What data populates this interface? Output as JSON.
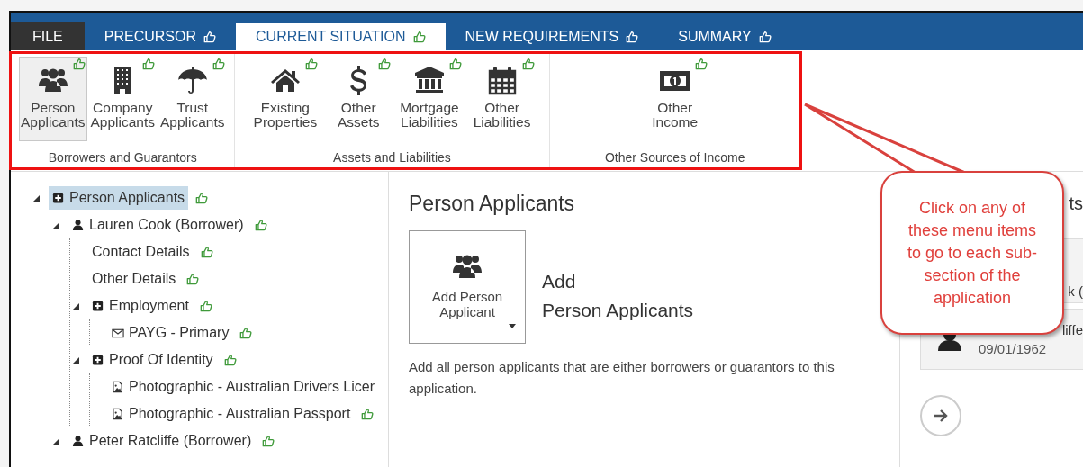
{
  "tabs": [
    {
      "label": "FILE",
      "kind": "menu",
      "selected": false
    },
    {
      "label": "PRECURSOR",
      "kind": "section",
      "selected": false
    },
    {
      "label": "CURRENT SITUATION",
      "kind": "section",
      "selected": true
    },
    {
      "label": "NEW REQUIREMENTS",
      "kind": "section",
      "selected": false
    },
    {
      "label": "SUMMARY",
      "kind": "section",
      "selected": false
    }
  ],
  "ribbon": {
    "groups": [
      {
        "label": "Borrowers and Guarantors",
        "items": [
          {
            "label": "Person Applicants",
            "selected": true
          },
          {
            "label": "Company Applicants",
            "selected": false
          },
          {
            "label": "Trust Applicants",
            "selected": false
          }
        ]
      },
      {
        "label": "Assets and Liabilities",
        "items": [
          {
            "label": "Existing Properties",
            "selected": false
          },
          {
            "label": "Other Assets",
            "selected": false
          },
          {
            "label": "Mortgage Liabilities",
            "selected": false
          },
          {
            "label": "Other Liabilities",
            "selected": false
          }
        ]
      },
      {
        "label": "Other Sources of Income",
        "items": [
          {
            "label": "Other Income",
            "selected": false
          }
        ]
      }
    ]
  },
  "tree": [
    {
      "label": "Person Applicants",
      "kind": "group",
      "selected": true,
      "expanded": true,
      "approved": true,
      "children": [
        {
          "label": "Lauren Cook (Borrower)",
          "kind": "person",
          "selected": false,
          "expanded": true,
          "approved": true,
          "children": [
            {
              "label": "Contact Details",
              "kind": "leaf",
              "selected": false,
              "approved": true
            },
            {
              "label": "Other Details",
              "kind": "leaf",
              "selected": false,
              "approved": true
            },
            {
              "label": "Employment",
              "kind": "group",
              "selected": false,
              "expanded": true,
              "approved": true,
              "children": [
                {
                  "label": "PAYG - Primary",
                  "kind": "record",
                  "selected": false,
                  "approved": true
                }
              ]
            },
            {
              "label": "Proof Of Identity",
              "kind": "group",
              "selected": false,
              "expanded": true,
              "approved": true,
              "children": [
                {
                  "label": "Photographic - Australian Drivers Licer",
                  "kind": "document",
                  "selected": false,
                  "approved": false
                },
                {
                  "label": "Photographic - Australian Passport",
                  "kind": "document",
                  "selected": false,
                  "approved": true
                }
              ]
            }
          ]
        },
        {
          "label": "Peter Ratcliffe (Borrower)",
          "kind": "person",
          "selected": false,
          "expanded": true,
          "approved": true
        }
      ]
    }
  ],
  "content": {
    "title": "Person Applicants",
    "add_button": "Add Person Applicant",
    "add_heading": [
      "Add",
      "Person Applicants"
    ],
    "description": "Add all person applicants that are either borrowers or guarantors to this application."
  },
  "side_panel": {
    "heading": "ts",
    "cards": [
      {
        "name": "k ("
      },
      {
        "name": "liffe",
        "date": "09/01/1962"
      }
    ]
  },
  "callout": {
    "text": "Click on any of these menu items to go to each sub-section of the application"
  }
}
